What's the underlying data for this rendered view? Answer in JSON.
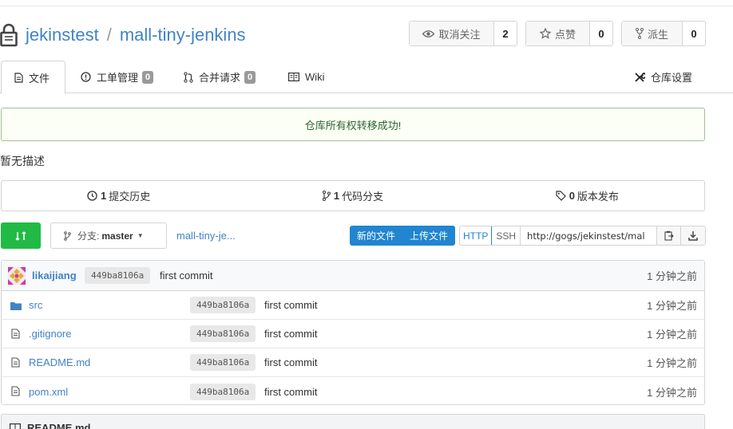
{
  "header": {
    "owner": "jekinstest",
    "separator": "/",
    "repo": "mall-tiny-jenkins",
    "watch": {
      "label": "取消关注",
      "count": "2"
    },
    "star": {
      "label": "点赞",
      "count": "0"
    },
    "fork": {
      "label": "派生",
      "count": "0"
    }
  },
  "tabs": {
    "files": "文件",
    "issues": "工单管理",
    "issues_count": "0",
    "pulls": "合并请求",
    "pulls_count": "0",
    "wiki": "Wiki",
    "settings": "仓库设置"
  },
  "flash": "仓库所有权转移成功!",
  "description": "暂无描述",
  "stats": {
    "commits_count": "1",
    "commits_label": "提交历史",
    "branches_count": "1",
    "branches_label": "代码分支",
    "releases_count": "0",
    "releases_label": "版本发布"
  },
  "toolbar": {
    "branch_prefix": "分支:",
    "branch_name": "master",
    "breadcrumb": "mall-tiny-je...",
    "new_file": "新的文件",
    "upload_file": "上传文件",
    "http": "HTTP",
    "ssh": "SSH",
    "clone_url": "http://gogs/jekinstest/mal"
  },
  "latest_commit": {
    "author": "likaijiang",
    "sha": "449ba8106a",
    "message": "first commit",
    "time": "1 分钟之前"
  },
  "files": [
    {
      "name": "src",
      "type": "folder",
      "sha": "449ba8106a",
      "message": "first commit",
      "time": "1 分钟之前"
    },
    {
      "name": ".gitignore",
      "type": "file",
      "sha": "449ba8106a",
      "message": "first commit",
      "time": "1 分钟之前"
    },
    {
      "name": "README.md",
      "type": "file",
      "sha": "449ba8106a",
      "message": "first commit",
      "time": "1 分钟之前"
    },
    {
      "name": "pom.xml",
      "type": "file",
      "sha": "449ba8106a",
      "message": "first commit",
      "time": "1 分钟之前"
    }
  ],
  "readme": {
    "title": "README.md"
  },
  "colors": {
    "accent": "#4183c4",
    "green": "#21ba45",
    "blue": "#2185d0"
  }
}
